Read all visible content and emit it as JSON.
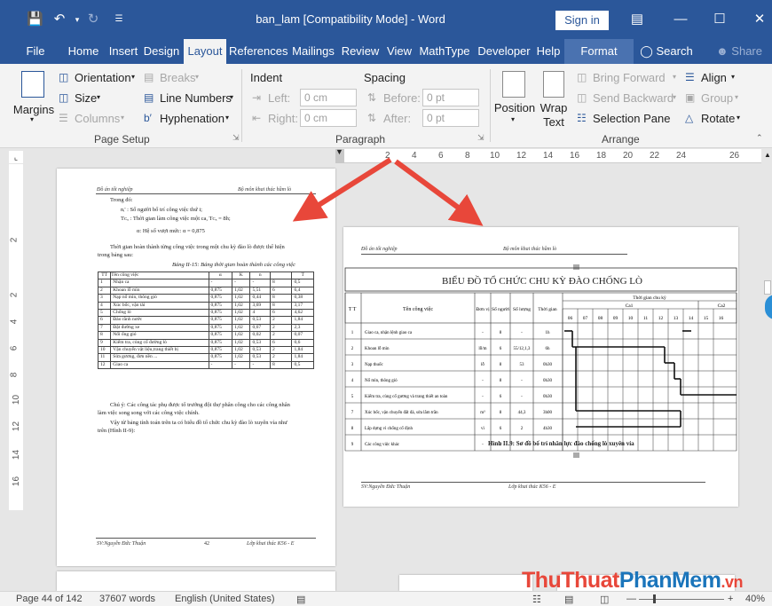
{
  "titlebar": {
    "title": "ban_lam [Compatibility Mode]  -  Word",
    "sign_in": "Sign in",
    "save_icon": "save-icon",
    "undo_icon": "undo-icon",
    "redo_icon": "redo-icon"
  },
  "tabs": [
    "File",
    "Home",
    "Insert",
    "Design",
    "Layout",
    "References",
    "Mailings",
    "Review",
    "View",
    "MathType",
    "Developer",
    "Help",
    "Format"
  ],
  "search_label": "Search",
  "share_label": "Share",
  "ribbon": {
    "margins": "Margins",
    "orientation": "Orientation",
    "size": "Size",
    "columns": "Columns",
    "breaks": "Breaks",
    "line_numbers": "Line Numbers",
    "hyphenation": "Hyphenation",
    "page_setup_label": "Page Setup",
    "indent": "Indent",
    "spacing": "Spacing",
    "left_label": "Left:",
    "right_label": "Right:",
    "before_label": "Before:",
    "after_label": "After:",
    "left_val": "0 cm",
    "right_val": "0 cm",
    "before_val": "0 pt",
    "after_val": "0 pt",
    "paragraph_label": "Paragraph",
    "position": "Position",
    "wrap_text_1": "Wrap",
    "wrap_text_2": "Text",
    "bring_forward": "Bring Forward",
    "send_backward": "Send Backward",
    "selection_pane": "Selection Pane",
    "align": "Align",
    "group": "Group",
    "rotate": "Rotate",
    "arrange_label": "Arrange"
  },
  "ruler": [
    "2",
    "4",
    "6",
    "8",
    "10",
    "12",
    "14",
    "16",
    "18",
    "20",
    "22",
    "24",
    "26"
  ],
  "vruler": [
    "2",
    "2",
    "4",
    "6",
    "8",
    "10",
    "12",
    "14",
    "16"
  ],
  "page1": {
    "header_left": "Đồ án tốt nghiệp",
    "header_right": "Bộ môn khai thác hầm lò",
    "in_which": "Trong đó:",
    "n_line": "nᵢ' : Số người bố trí công việc thứ i;",
    "t_line": "Tᴄₓ : Thời gian làm công việc một ca, Tᴄₓ = 8h;",
    "alpha_line": "α: Hệ số vượt mức: α = 0,875",
    "para1": "Thời gian hoàn thành từng công việc trong một chu kỳ đào lò được thể hiện",
    "para1b": "trong bảng sau:",
    "table_caption": "Bảng II-15: Bảng thời gian hoàn thành các công việc",
    "table_headers": [
      "TT",
      "Tên công việc",
      "α",
      "K",
      "n",
      "T"
    ],
    "table_rows": [
      [
        "1",
        "Nhận ca",
        "-",
        "-",
        "-",
        "8",
        "0,5"
      ],
      [
        "2",
        "Khoan lỗ mìn",
        "0,875",
        "1,02",
        "5,51",
        "6",
        "6,4"
      ],
      [
        "3",
        "Nạp nổ mìn, thông gió",
        "0,875",
        "1,02",
        "0,44",
        "8",
        "0,38"
      ],
      [
        "4",
        "Xúc bốc, vận tải",
        "0,875",
        "1,02",
        "3,69",
        "8",
        "3,17"
      ],
      [
        "5",
        "Chống lò",
        "0,875",
        "1,02",
        "4",
        "6",
        "4,62"
      ],
      [
        "6",
        "Đào rãnh nước",
        "0,875",
        "1,02",
        "0,53",
        "2",
        "1,84"
      ],
      [
        "7",
        "Đặt đường xe",
        "0,875",
        "1,02",
        "0,67",
        "2",
        "2,3"
      ],
      [
        "8",
        "Nối ống gió",
        "0,875",
        "1,02",
        "0,02",
        "2",
        "0,07"
      ],
      [
        "9",
        "Kiểm tra, củng cố đường lò",
        "0,875",
        "1,02",
        "0,53",
        "6",
        "0,6"
      ],
      [
        "10",
        "Vận chuyển vật liệu,trang thiết bị",
        "0,875",
        "1,02",
        "0,53",
        "2",
        "1,84"
      ],
      [
        "11",
        "Sửa gương, đơn nền ...",
        "0,875",
        "1,02",
        "0,53",
        "2",
        "1,84"
      ],
      [
        "12",
        "Giao ca",
        "-",
        "-",
        "-",
        "8",
        "0,5"
      ]
    ],
    "note1": "Chú ý: Các công tác phụ được tổ trưởng đội thợ phân công cho các công nhân",
    "note2": "làm việc song song với các công việc chính.",
    "note3": "Vậy từ bảng tính toán trên ta có biểu đồ tổ chức chu kỳ đào lò xuyên vỉa  như",
    "note4": "trên (Hình II-9):",
    "footer_left": "SV:Nguyễn Đức Thuận",
    "footer_mid": "42",
    "footer_right": "Lớp khai thác K56 - E"
  },
  "page2": {
    "header_left": "Đồ án tốt nghiệp",
    "header_right": "Bộ môn khai thác hầm lò",
    "chart_title": "BIỂU ĐỒ TỔ CHỨC CHU KỲ ĐÀO CHỐNG LÒ",
    "col_tt": "T T",
    "col_name": "Tên công việc",
    "col_unit": "Đơn vị",
    "col_qty": "Số lượng",
    "col_people": "Số người",
    "col_time": "Thời gian",
    "time_header": "Thời gian chu kỳ",
    "ca1": "Ca1",
    "ca2": "Ca2",
    "hours": [
      "06",
      "07",
      "08",
      "09",
      "10",
      "11",
      "12",
      "13",
      "14",
      "15",
      "16"
    ],
    "rows": [
      [
        "1",
        "Giao ca, nhận lệnh giao ca",
        "-",
        "8",
        "-",
        "1h"
      ],
      [
        "2",
        "Khoan lỗ mìn",
        "lỗ/m",
        "6",
        "55/12,1,3",
        "6h"
      ],
      [
        "3",
        "Nạp thuốc",
        "lỗ",
        "8",
        "53",
        "0h30"
      ],
      [
        "4",
        "Nổ mìn, thông gió",
        "-",
        "8",
        "-",
        "0h30"
      ],
      [
        "5",
        "Kiểm tra, củng cố gương và trang thiết an toàn",
        "-",
        "6",
        "-",
        "0h30"
      ],
      [
        "7",
        "Xúc bốc, vận chuyển đất đá, sửa lắm trần",
        "m³",
        "8",
        "44,3",
        "3h00"
      ],
      [
        "8",
        "Lắp dựng vì chống cố định",
        "vì",
        "6",
        "2",
        "4h30"
      ],
      [
        "9",
        "Các công việc khác",
        "-",
        "2",
        "-",
        "-"
      ]
    ],
    "figure_caption": "Hình II.9: Sơ đồ bố trí nhân lực đào chống lò xuyên vỉa",
    "footer_left": "SV:Nguyễn Đức Thuận",
    "footer_right": "Lớp khai thác K56 - E"
  },
  "status": {
    "page": "Page 44 of 142",
    "words": "37607 words",
    "language": "English (United States)",
    "zoom": "40%"
  },
  "watermark": "ThuThuatPhanMem.vn",
  "colors": {
    "brand": "#2b579a",
    "arrow": "#e8473a"
  }
}
